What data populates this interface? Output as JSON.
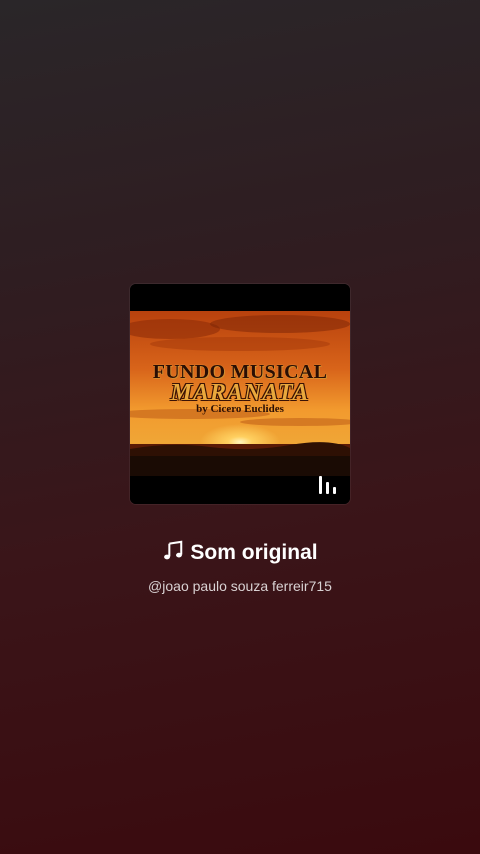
{
  "album_cover": {
    "title_line1": "FUNDO MUSICAL",
    "title_line2": "MARANATA",
    "byline": "by Cicero Euclides"
  },
  "sound": {
    "title": "Som original",
    "author": "@joao paulo souza ferreir715"
  },
  "icons": {
    "note": "music-note-icon",
    "playing": "playing-bars-icon"
  },
  "colors": {
    "background_top": "#2a2629",
    "background_bottom": "#3a0a0e",
    "text_primary": "#ffffff",
    "text_secondary": "#d9d2d3"
  }
}
